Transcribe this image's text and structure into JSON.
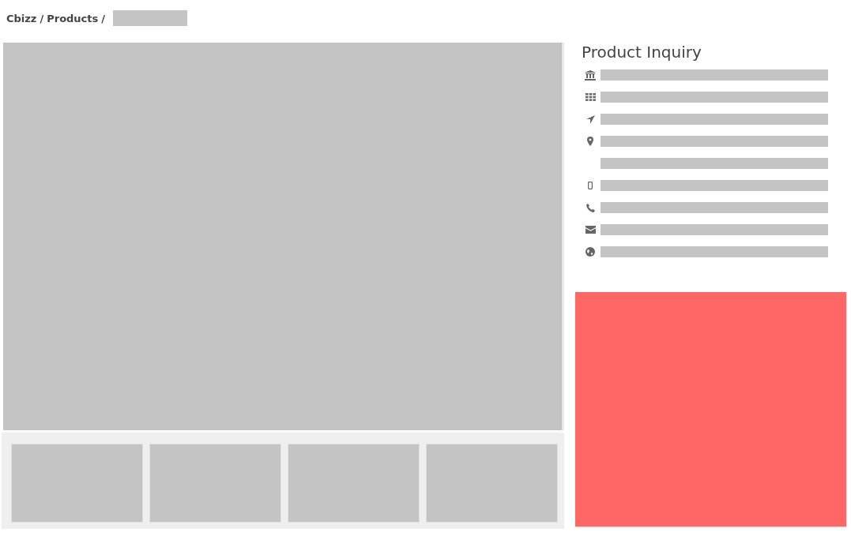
{
  "breadcrumb": {
    "items": [
      "Cbizz",
      "Products"
    ],
    "separator": "/"
  },
  "gallery": {
    "thumbnails": [
      {
        "kind": "placeholder"
      },
      {
        "kind": "placeholder"
      },
      {
        "kind": "placeholder"
      },
      {
        "kind": "placeholder"
      }
    ]
  },
  "inquiry": {
    "title": "Product Inquiry",
    "rows": [
      {
        "kind": "company"
      },
      {
        "kind": "category"
      },
      {
        "kind": "direction"
      },
      {
        "kind": "location"
      },
      {
        "kind": "blank"
      },
      {
        "kind": "mobile"
      },
      {
        "kind": "phone"
      },
      {
        "kind": "email"
      },
      {
        "kind": "website"
      }
    ]
  }
}
